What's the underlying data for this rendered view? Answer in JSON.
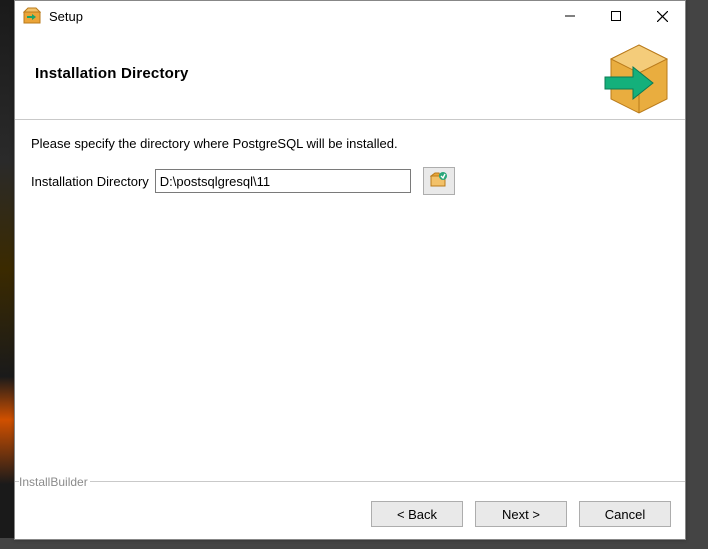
{
  "window": {
    "title": "Setup"
  },
  "header": {
    "heading": "Installation Directory"
  },
  "body": {
    "instruction": "Please specify the directory where PostgreSQL will be installed.",
    "field_label": "Installation Directory",
    "field_value": "D:\\postsqlgresql\\11"
  },
  "footer": {
    "builder": "InstallBuilder",
    "back": "< Back",
    "next": "Next >",
    "cancel": "Cancel"
  }
}
